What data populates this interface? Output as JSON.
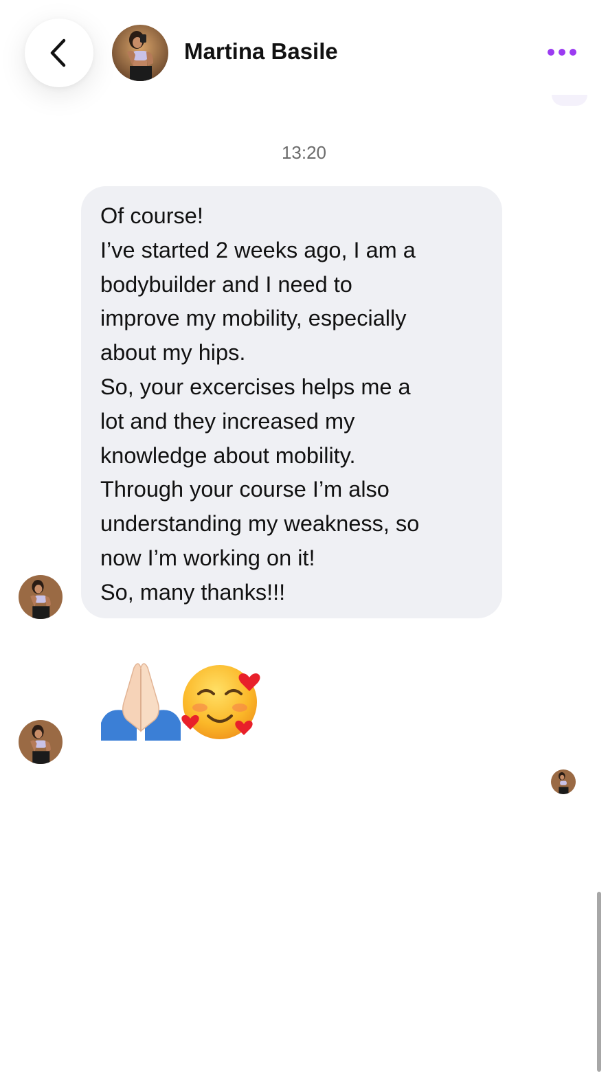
{
  "header": {
    "back_icon": "chevron-left-icon",
    "avatar_icon": "contact-avatar",
    "contact_name": "Martina Basile",
    "more_icon": "more-horizontal-icon",
    "accent_color": "#9b3bf1"
  },
  "conversation": {
    "timestamp": "13:20",
    "message_lines": [
      "Of course!",
      "I’ve started 2 weeks ago, I am a",
      "bodybuilder and I need to",
      "improve my mobility, especially",
      "about my hips.",
      "So, your excercises helps me a",
      "lot and they increased my",
      "knowledge about mobility.",
      "Through your course I’m also",
      "understanding my weakness, so",
      "now I’m working on it!",
      "So, many thanks!!!"
    ],
    "emoji_message_icons": [
      "folded-hands-emoji",
      "smiling-face-with-hearts-emoji"
    ],
    "seen_indicator_icon": "seen-avatar"
  },
  "colors": {
    "bubble_background": "#eff0f4",
    "text": "#111111",
    "timestamp": "#6b6b6b"
  }
}
